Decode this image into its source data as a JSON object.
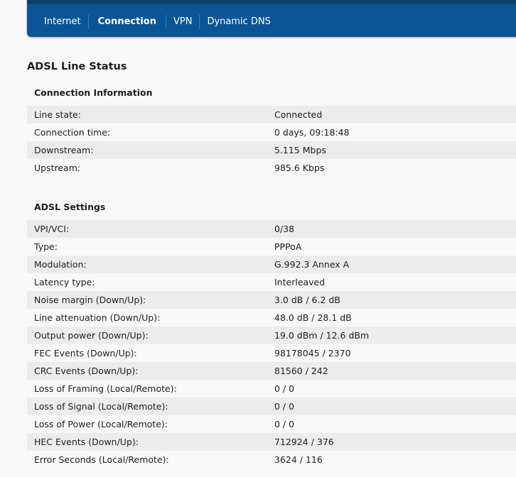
{
  "nav": {
    "items": [
      {
        "label": "Internet"
      },
      {
        "label": "Connection"
      },
      {
        "label": "VPN"
      },
      {
        "label": "Dynamic DNS"
      }
    ]
  },
  "page_title": "ADSL Line Status",
  "connection_info": {
    "title": "Connection Information",
    "rows": [
      {
        "label": "Line state:",
        "value": "Connected"
      },
      {
        "label": "Connection time:",
        "value": "0 days, 09:18:48"
      },
      {
        "label": "Downstream:",
        "value": "5.115 Mbps"
      },
      {
        "label": "Upstream:",
        "value": "985.6 Kbps"
      }
    ]
  },
  "adsl_settings": {
    "title": "ADSL Settings",
    "rows": [
      {
        "label": "VPI/VCI:",
        "value": "0/38"
      },
      {
        "label": "Type:",
        "value": "PPPoA"
      },
      {
        "label": "Modulation:",
        "value": "G.992.3 Annex A"
      },
      {
        "label": "Latency type:",
        "value": "Interleaved"
      },
      {
        "label": "Noise margin (Down/Up):",
        "value": "3.0 dB / 6.2 dB"
      },
      {
        "label": "Line attenuation (Down/Up):",
        "value": "48.0 dB / 28.1 dB"
      },
      {
        "label": "Output power (Down/Up):",
        "value": "19.0 dBm / 12.6 dBm"
      },
      {
        "label": "FEC Events (Down/Up):",
        "value": "98178045 / 2370"
      },
      {
        "label": "CRC Events (Down/Up):",
        "value": "81560 / 242"
      },
      {
        "label": "Loss of Framing (Local/Remote):",
        "value": "0 / 0"
      },
      {
        "label": "Loss of Signal (Local/Remote):",
        "value": "0 / 0"
      },
      {
        "label": "Loss of Power (Local/Remote):",
        "value": "0 / 0"
      },
      {
        "label": "HEC Events (Down/Up):",
        "value": "712924 / 376"
      },
      {
        "label": "Error Seconds (Local/Remote):",
        "value": "3624 / 116"
      }
    ]
  }
}
